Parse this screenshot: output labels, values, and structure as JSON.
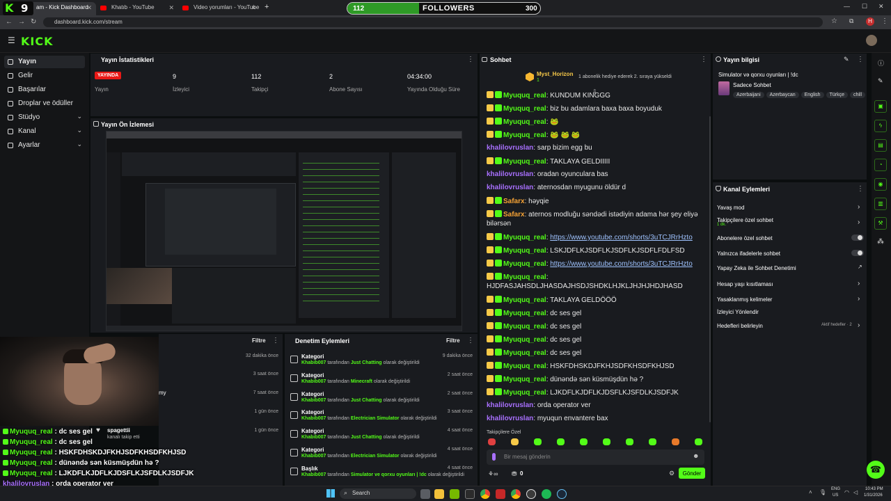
{
  "browser": {
    "tabs": [
      {
        "label": "am - Kick Dashboard"
      },
      {
        "label": "Khatıb - YouTube"
      },
      {
        "label": "Video yorumları - YouTube Stu"
      }
    ],
    "new_tab": "+",
    "url": "dashboard.kick.com/stream",
    "profile_initial": "H"
  },
  "overlay": {
    "kick_badge": "K",
    "badge_count": "9",
    "followers_current": "112",
    "followers_label": "FOLLOWERS",
    "followers_goal": "300",
    "followers_fraction": 0.373
  },
  "header": {
    "logo": "KICK"
  },
  "sidebar": {
    "items": [
      {
        "label": "Yayın",
        "active": true
      },
      {
        "label": "Gelir"
      },
      {
        "label": "Başarılar"
      },
      {
        "label": "Droplar ve ödüller"
      },
      {
        "label": "Stüdyo",
        "chevron": "⌄"
      },
      {
        "label": "Kanal",
        "chevron": "⌄"
      },
      {
        "label": "Ayarlar",
        "chevron": "⌄"
      }
    ]
  },
  "stats": {
    "title": "Yayın İstatistikleri",
    "live_badge": "YAYINDA",
    "live_label": "Yayın",
    "items": [
      {
        "value": "9",
        "label": "İzleyici"
      },
      {
        "value": "112",
        "label": "Takipçi"
      },
      {
        "value": "2",
        "label": "Abone Sayısı"
      },
      {
        "value": "04:34:00",
        "label": "Yayında Olduğu Süre"
      }
    ]
  },
  "preview": {
    "title": "Yayın Ön İzlemesi"
  },
  "activity": {
    "filter_label": "Filtre",
    "left": {
      "times": [
        "32 dakika önce",
        "3 saat önce",
        "7 saat önce",
        "1 gün önce",
        "1 gün önce"
      ],
      "partial_text": "my",
      "follow_name": "spagettii",
      "follow_text": "kanalı takip etti"
    },
    "mod": {
      "title": "Denetim Eylemleri",
      "items": [
        {
          "title": "Kategori",
          "user": "Khabib007",
          "mid": "tarafından",
          "value": "Just Chatting",
          "end": "olarak değiştirildi",
          "time": "9 dakika önce"
        },
        {
          "title": "Kategori",
          "user": "Khabib007",
          "mid": "tarafından",
          "value": "Minecraft",
          "end": "olarak değiştirildi",
          "time": "2 saat önce"
        },
        {
          "title": "Kategori",
          "user": "Khabib007",
          "mid": "tarafından",
          "value": "Just Chatting",
          "end": "olarak değiştirildi",
          "time": "2 saat önce"
        },
        {
          "title": "Kategori",
          "user": "Khabib007",
          "mid": "tarafından",
          "value": "Electrician Simulator",
          "end": "olarak değiştirildi",
          "time": "3 saat önce"
        },
        {
          "title": "Kategori",
          "user": "Khabib007",
          "mid": "tarafından",
          "value": "Just Chatting",
          "end": "olarak değiştirildi",
          "time": "4 saat önce"
        },
        {
          "title": "Kategori",
          "user": "Khabib007",
          "mid": "tarafından",
          "value": "Electrician Simulator",
          "end": "olarak değiştirildi",
          "time": "4 saat önce"
        },
        {
          "title": "Başlık",
          "user": "Khabib007",
          "mid": "tarafından",
          "value": "Simulator ve qorxu oyunları | !dc",
          "end": "olarak değiştirildi",
          "time": "4 saat önce"
        }
      ]
    }
  },
  "chat": {
    "title": "Sohbet",
    "pinned_user": "Myst_Horizon",
    "pinned_count": "1",
    "pinned_text": "1 abonelik hediye ederek 2. sıraya yükseldi",
    "messages": [
      {
        "user": "Myuquq_real",
        "text": "KUNDUM KINGGG",
        "color": "green",
        "badges": 2
      },
      {
        "user": "Myuquq_real",
        "text": "biz bu adamlara baxa baxa boyuduk",
        "color": "green",
        "badges": 2
      },
      {
        "user": "Myuquq_real",
        "text": "🐸",
        "color": "green",
        "badges": 2
      },
      {
        "user": "Myuquq_real",
        "text": "🐸 🐸 🐸",
        "color": "green",
        "badges": 2
      },
      {
        "user": "khalilovruslan",
        "text": "sarp bizim egg bu",
        "color": "purple",
        "badges": 0
      },
      {
        "user": "Myuquq_real",
        "text": "TAKLAYA GELDIIIII",
        "color": "green",
        "badges": 2
      },
      {
        "user": "khalilovruslan",
        "text": "oradan oyunculara bas",
        "color": "purple",
        "badges": 0
      },
      {
        "user": "khalilovruslan",
        "text": "aternosdan myugunu öldür d",
        "color": "purple",
        "badges": 0
      },
      {
        "user": "Safarx",
        "text": "həyqie",
        "color": "orange",
        "badges": 2
      },
      {
        "user": "Safarx",
        "text": "aternos modluğu səndədi istədiyin adama hər şey eliyə",
        "cont": "bilərsən",
        "color": "orange",
        "badges": 2
      },
      {
        "user": "Myuquq_real",
        "text": "https://www.youtube.com/shorts/3uTCJRrHzto",
        "color": "green",
        "badges": 2,
        "link": true
      },
      {
        "user": "Myuquq_real",
        "text": "LSKJDFLKJSDFLKJSDFLKJSDFLFDLFSD",
        "color": "green",
        "badges": 2
      },
      {
        "user": "Myuquq_real",
        "text": "https://www.youtube.com/shorts/3uTCJRrHzto",
        "color": "green",
        "badges": 2,
        "link": true
      },
      {
        "user": "Myuquq_real",
        "text": "",
        "cont": "HJDFASJAHSDLJHASDAJHSDJSHDKLHJKLJHJHJHDJHASD",
        "color": "green",
        "badges": 2
      },
      {
        "user": "Myuquq_real",
        "text": "TAKLAYA GELDÖÖÖ",
        "color": "green",
        "badges": 2
      },
      {
        "user": "Myuquq_real",
        "text": "dc ses gel",
        "color": "green",
        "badges": 2
      },
      {
        "user": "Myuquq_real",
        "text": "dc ses gel",
        "color": "green",
        "badges": 2
      },
      {
        "user": "Myuquq_real",
        "text": "dc ses gel",
        "color": "green",
        "badges": 2
      },
      {
        "user": "Myuquq_real",
        "text": "dc ses gel",
        "color": "green",
        "badges": 2
      },
      {
        "user": "Myuquq_real",
        "text": "HSKFDHSKDJFKHJSDFKHSDFKHJSD",
        "color": "green",
        "badges": 2
      },
      {
        "user": "Myuquq_real",
        "text": "dünəndə sən küsmüşdün hə ?",
        "color": "green",
        "badges": 2
      },
      {
        "user": "Myuquq_real",
        "text": "LJKDFLKJDFLKJDSFLKJSFDLKJSDFJK",
        "color": "green",
        "badges": 2
      },
      {
        "user": "khalilovruslan",
        "text": "orda operator ver",
        "color": "purple",
        "badges": 0
      },
      {
        "user": "khalilovruslan",
        "text": "myuqun envantere bax",
        "color": "purple",
        "badges": 0
      }
    ],
    "followers_only": "Takipçilere Özel",
    "input_placeholder": "Bir mesaj gönderin",
    "points": "0",
    "send_label": "Gönder"
  },
  "stream_info": {
    "title": "Yayın bilgisi",
    "stream_title": "Simulator və qorxu oyunları | !dc",
    "category": "Sadece Sohbet",
    "tags": [
      "Azerbaijani",
      "Azerbaycan",
      "English",
      "Türkçe",
      "chill"
    ]
  },
  "channel_actions": {
    "title": "Kanal Eylemleri",
    "items": [
      {
        "label": "Yavaş mod",
        "control": "chevron"
      },
      {
        "label": "Takipçilere özel sohbet",
        "sub": "1 dk.",
        "control": "chevron"
      },
      {
        "label": "Abonelere özel sohbet",
        "control": "toggle"
      },
      {
        "label": "Yalnızca ifadelerle sohbet",
        "control": "toggle"
      },
      {
        "label": "Yapay Zeka ile Sohbet Denetimi",
        "control": "external"
      },
      {
        "label": "Hesap yaşı kısıtlaması",
        "control": "chevron"
      },
      {
        "label": "Yasaklanmış kelimeler",
        "control": "chevron"
      },
      {
        "label": "İzleyici Yönlendir",
        "control": "none"
      },
      {
        "label": "Hedefleri belirleyin",
        "extra": "Aktif hedefler · 2",
        "control": "chevron"
      }
    ]
  },
  "overlay_chat": [
    {
      "user": "Myuquq_real",
      "text": "dc ses gel",
      "color": "green"
    },
    {
      "user": "Myuquq_real",
      "text": "dc ses gel",
      "color": "green"
    },
    {
      "user": "Myuquq_real",
      "text": "HSKFDHSKDJFKHJSDFKHSDFKHJSD",
      "color": "green"
    },
    {
      "user": "Myuquq_real",
      "text": "dünəndə sən küsmüşdün hə ?",
      "color": "green"
    },
    {
      "user": "Myuquq_real",
      "text": "LJKDFLKJDFLKJDSFLKJSFDLKJSDFJK",
      "color": "green"
    },
    {
      "user": "khalilovruslan",
      "text": "orda operator ver",
      "color": "purple"
    },
    {
      "user": "khalilovruslan",
      "text": "myuqun envantere bax",
      "color": "purple"
    }
  ],
  "taskbar": {
    "search": "Search",
    "lang": "ENG",
    "region": "US",
    "time": "10:43 PM",
    "date": "1/31/2026"
  },
  "colors": {
    "accent": "#53fc18",
    "live": "#e91916",
    "bg": "#0b0e0f",
    "panel": "#191b1f"
  }
}
